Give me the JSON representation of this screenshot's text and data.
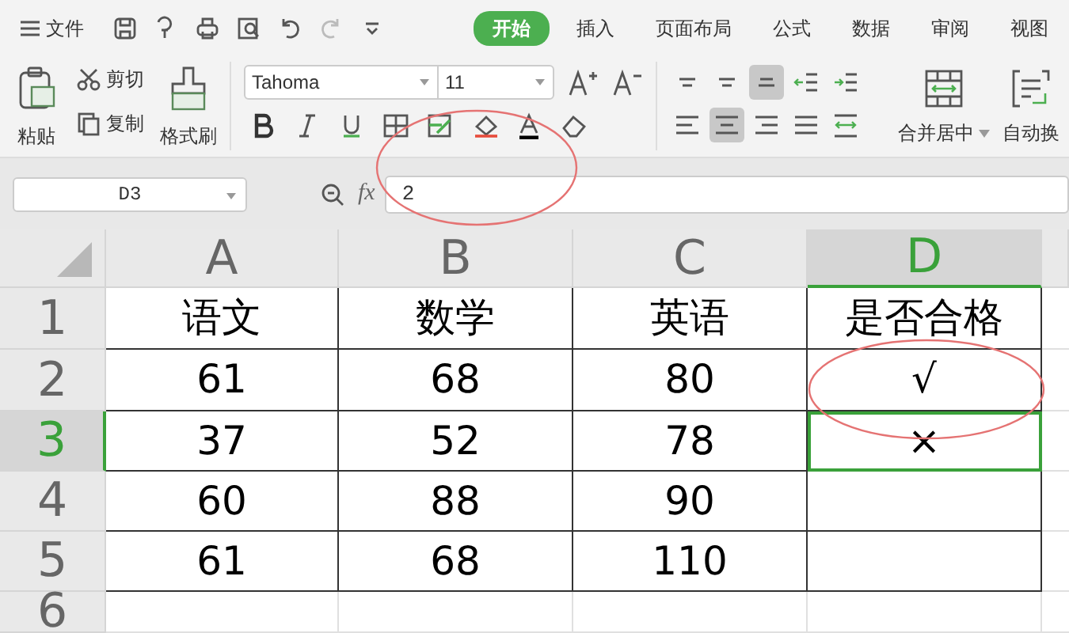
{
  "menu": {
    "file_label": "文件",
    "tabs": [
      {
        "label": "开始",
        "selected": true
      },
      {
        "label": "插入",
        "selected": false
      },
      {
        "label": "页面布局",
        "selected": false
      },
      {
        "label": "公式",
        "selected": false
      },
      {
        "label": "数据",
        "selected": false
      },
      {
        "label": "审阅",
        "selected": false
      },
      {
        "label": "视图",
        "selected": false
      }
    ]
  },
  "ribbon": {
    "paste": "粘贴",
    "cut": "剪切",
    "copy": "复制",
    "format_painter": "格式刷",
    "font_name": "Tahoma",
    "font_size": "11",
    "align_buttons": [
      {
        "kind": "top",
        "selected": false
      },
      {
        "kind": "middle",
        "selected": false
      },
      {
        "kind": "bottom",
        "selected": true
      },
      {
        "kind": "outdent",
        "selected": false
      },
      {
        "kind": "indent",
        "selected": false
      },
      {
        "kind": "left",
        "selected": false
      },
      {
        "kind": "center",
        "selected": true
      },
      {
        "kind": "right",
        "selected": false
      },
      {
        "kind": "justify",
        "selected": false
      },
      {
        "kind": "distribute",
        "selected": false
      }
    ],
    "merge": "合并居中",
    "wrap": "自动换"
  },
  "formula_bar": {
    "name_box": "D3",
    "fx": "fx",
    "formula": "2"
  },
  "sheet": {
    "columns": [
      {
        "label": "A",
        "selected": false
      },
      {
        "label": "B",
        "selected": false
      },
      {
        "label": "C",
        "selected": false
      },
      {
        "label": "D",
        "selected": true
      }
    ],
    "rows": [
      {
        "label": "1",
        "selected": false,
        "cells": [
          "语文",
          "数学",
          "英语",
          "是否合格"
        ]
      },
      {
        "label": "2",
        "selected": false,
        "cells": [
          "61",
          "68",
          "80",
          "√"
        ]
      },
      {
        "label": "3",
        "selected": true,
        "cells": [
          "37",
          "52",
          "78",
          "×"
        ]
      },
      {
        "label": "4",
        "selected": false,
        "cells": [
          "60",
          "88",
          "90",
          ""
        ]
      },
      {
        "label": "5",
        "selected": false,
        "cells": [
          "61",
          "68",
          "110",
          ""
        ]
      },
      {
        "label": "6",
        "selected": false,
        "cells": [
          "",
          "",
          "",
          ""
        ]
      }
    ]
  }
}
